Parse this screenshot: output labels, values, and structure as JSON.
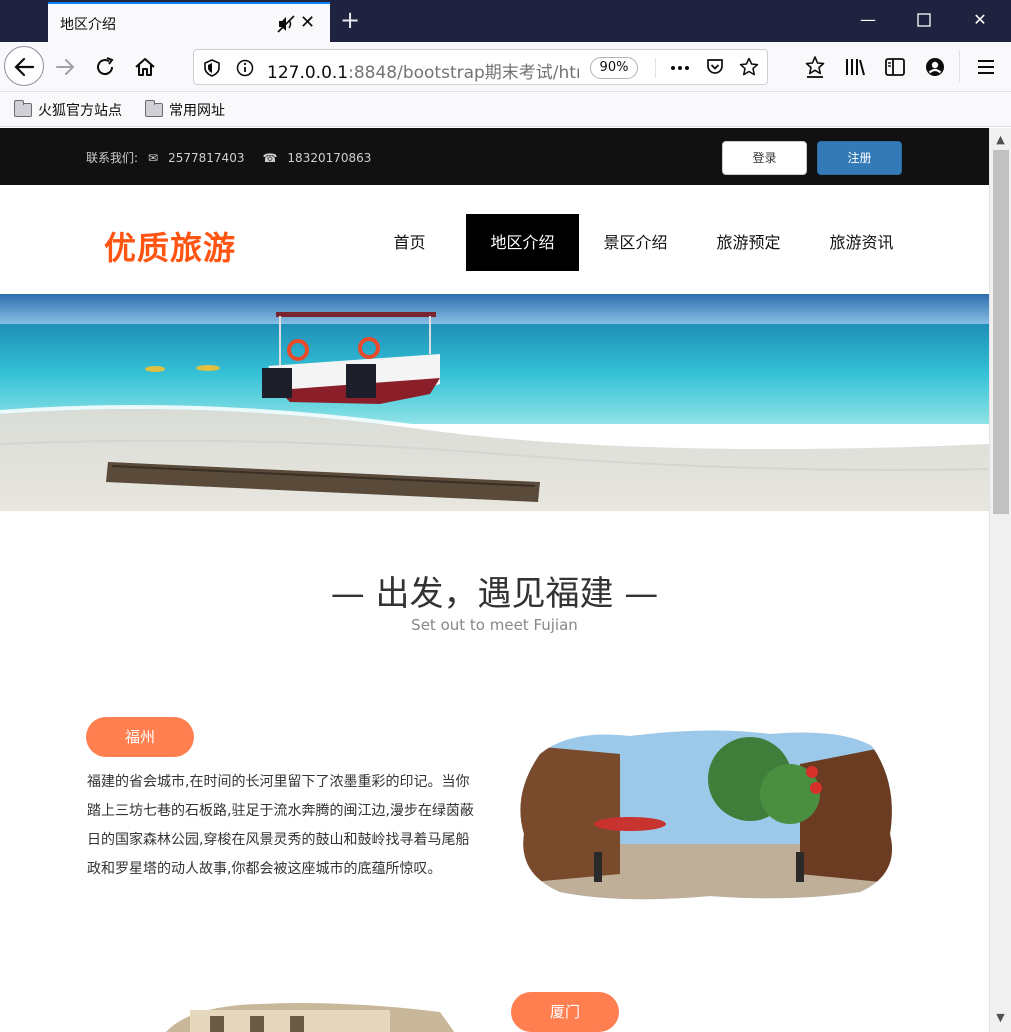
{
  "browser": {
    "tab_title": "地区介绍",
    "url_host": "127.0.0.1",
    "url_rest": ":8848/bootstrap期末考试/htm",
    "zoom": "90%",
    "bookmarks": [
      "火狐官方站点",
      "常用网址"
    ]
  },
  "topbar": {
    "contact_label": "联系我们:",
    "email": "2577817403",
    "phone": "18320170863",
    "login": "登录",
    "register": "注册"
  },
  "header": {
    "logo": "优质旅游",
    "menu": [
      "首页",
      "地区介绍",
      "景区介绍",
      "旅游预定",
      "旅游资讯"
    ],
    "active_index": 1
  },
  "section": {
    "title": "— 出发，遇见福建 —",
    "subtitle": "Set out to meet Fujian"
  },
  "regions": [
    {
      "name": "福州",
      "description": "福建的省会城市,在时间的长河里留下了浓墨重彩的印记。当你踏上三坊七巷的石板路,驻足于流水奔腾的闽江边,漫步在绿茵蔽日的国家森林公园,穿梭在风景灵秀的鼓山和鼓岭找寻着马尾船政和罗星塔的动人故事,你都会被这座城市的底蕴所惊叹。"
    },
    {
      "name": "厦门"
    }
  ],
  "colors": {
    "accent": "#ff7f50",
    "logo": "#ff5511",
    "register_button": "#337ab7",
    "topbar": "#111111"
  }
}
